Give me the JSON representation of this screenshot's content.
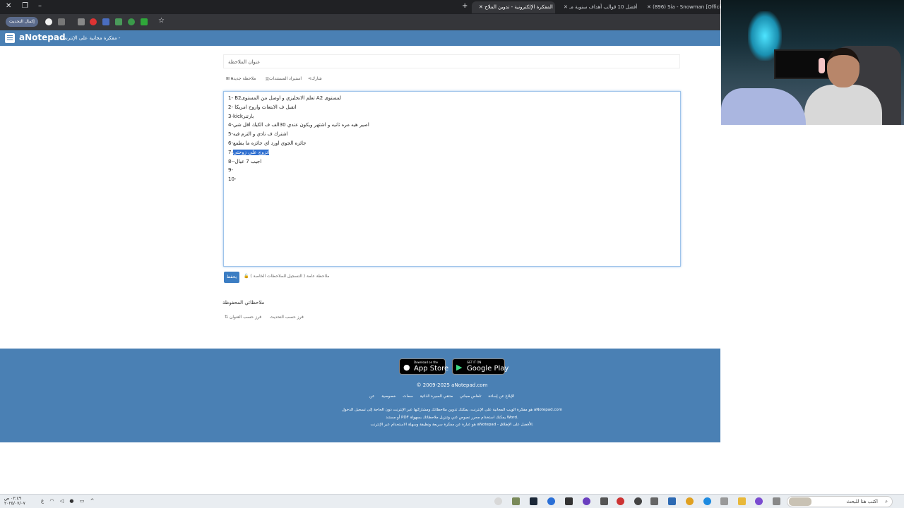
{
  "browser": {
    "tabs": [
      {
        "label": "(896) Sia - Snowman [Official V",
        "active": false
      },
      {
        "label": "أفضل 10 قوالب أهداف سنوية مـ",
        "active": false
      },
      {
        "label": "المفكرة الإلكترونية - تدوين الملاح",
        "active": true
      }
    ],
    "update_button": "إكمال التحديث"
  },
  "site": {
    "brand": "aNotepad",
    "tagline": "مفكرة مجانية على الإنترنت -"
  },
  "note": {
    "title_placeholder": "عنوان الملاحظة",
    "actions": {
      "new_note": "ملاحظة جديدة",
      "import": "استيراد المستندات",
      "share": "شارك"
    },
    "lines": [
      {
        "text": "1- B2تعلم الانجليزي و اوصل من المستوى A2 لمستوى",
        "selected": false
      },
      {
        "text": "2- اتقبل ف الابتعاث واروح امريكا",
        "selected": false
      },
      {
        "text": "3-kickبارتنر",
        "selected": false
      },
      {
        "text": "4-اصير هيه مره ثانيه و اشتهر ويكون عندي 30الف ف الكيك اقل شي",
        "selected": false
      },
      {
        "text": "5-اشترك ف نادي و التزم فيه",
        "selected": false
      },
      {
        "text": "6-جائزه الجوي اورد اي جائزه ما يطمع",
        "selected": false
      },
      {
        "text": "7-",
        "highlight": "اتزوج علي زوجتي",
        "selected": true
      },
      {
        "text": "8--اجيب 7 عيال",
        "selected": false
      },
      {
        "text": "9-",
        "selected": false
      },
      {
        "text": "10-",
        "selected": false
      }
    ],
    "save_button": "يحفظ",
    "save_note": "ملاحظة عامة ( التسجيل للملاحظات الخاصة )"
  },
  "saved": {
    "title": "ملاحظاتي المحفوظة",
    "sort_by_title": "فرز حسب العنوان",
    "sort_by_update": "فرز حسب التحديث"
  },
  "footer": {
    "app_store_small": "Download on the",
    "app_store_big": "App Store",
    "google_play_small": "GET IT ON",
    "google_play_big": "Google Play",
    "copyright": "© 2009-2025 aNotepad.com",
    "links": [
      "عن",
      "خصوصية",
      "سمات",
      "منتقي السيرة الذاتية",
      "تلفاس مجاني",
      "الإبلاغ عن إساءة"
    ],
    "about_lines": [
      "هو مفكرة الويب المجانية على الإنترنت، يمكنك تدوين ملاحظاتك ومشاركتها عبر الإنترنت دون الحاجة إلى تسجيل الدخول aNotepad.com",
      "أو مستند PDF يمكنك استخدام محرر نصوص غني وتنزيل ملاحظاتك بسهولة Word.",
      "هو عبارة عن مفكرة سريعة ونظيفة وسهلة الاستخدام عبر الإنترنت aNotepad - الأفضل على الإطلاق."
    ]
  },
  "taskbar": {
    "time": "٠٢:٤٩ ص",
    "date": "٢٠٢٥/٠٧/٠٧",
    "search_placeholder": "اكتب هنا للبحث"
  }
}
